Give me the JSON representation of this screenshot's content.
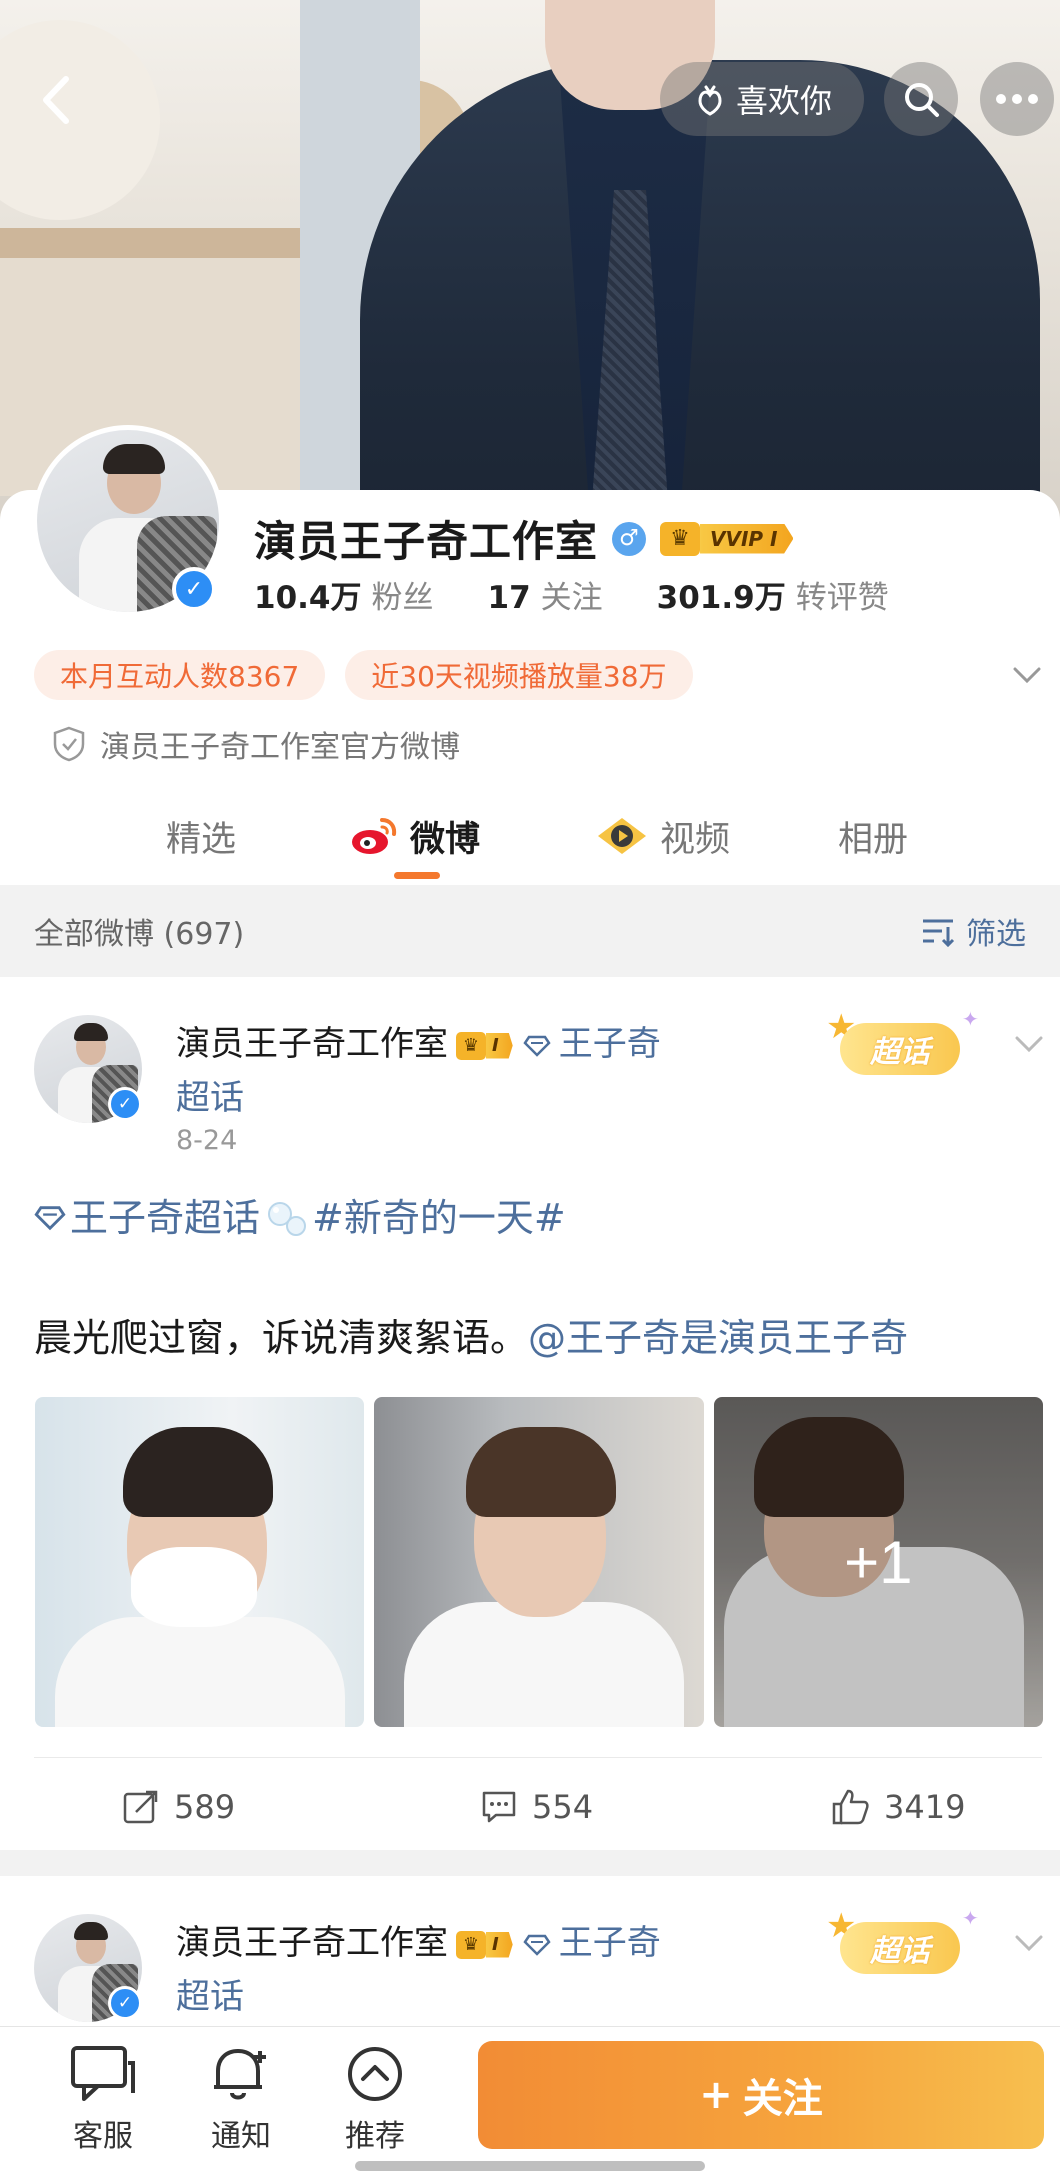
{
  "header": {
    "like_you_label": "喜欢你",
    "back_icon": "chevron-left-icon",
    "search_icon": "search-icon",
    "more_icon": "more-dots-icon"
  },
  "profile": {
    "name": "演员王子奇工作室",
    "gender": "male",
    "vip_label": "VVIP I",
    "stats": [
      {
        "value": "10.4万",
        "label": "粉丝"
      },
      {
        "value": "17",
        "label": "关注"
      },
      {
        "value": "301.9万",
        "label": "转评赞"
      }
    ],
    "tags": [
      "本月互动人数8367",
      "近30天视频播放量38万"
    ],
    "official_desc": "演员王子奇工作室官方微博"
  },
  "tabs": [
    {
      "label": "精选",
      "active": false
    },
    {
      "label": "微博",
      "active": true
    },
    {
      "label": "视频",
      "active": false
    },
    {
      "label": "相册",
      "active": false
    }
  ],
  "filter": {
    "count_label": "全部微博 (697)",
    "filter_label": "筛选"
  },
  "posts": [
    {
      "author": "演员王子奇工作室",
      "vip_level": "I",
      "super_topic": "王子奇",
      "super_topic_suffix": "超话",
      "super_badge": "超话",
      "time": "8-24",
      "topic_link": "王子奇超话",
      "hashtag": "#新奇的一天#",
      "body": "晨光爬过窗，诉说清爽絮语。",
      "mention": "@王子奇是演员王子奇",
      "extra_photos": "+1",
      "reposts": "589",
      "comments": "554",
      "likes": "3419"
    },
    {
      "author": "演员王子奇工作室",
      "vip_level": "I",
      "super_topic": "王子奇",
      "super_topic_suffix": "超话",
      "super_badge": "超话"
    }
  ],
  "bottom_bar": {
    "service_label": "客服",
    "notify_label": "通知",
    "recommend_label": "推荐",
    "follow_label": "关注",
    "follow_plus": "+"
  },
  "colors": {
    "accent_orange": "#f4782d",
    "link_blue": "#4d6f9c",
    "tag_bg": "#fdeee7",
    "tag_text": "#f06a37",
    "verify_blue": "#2d8ef5"
  }
}
